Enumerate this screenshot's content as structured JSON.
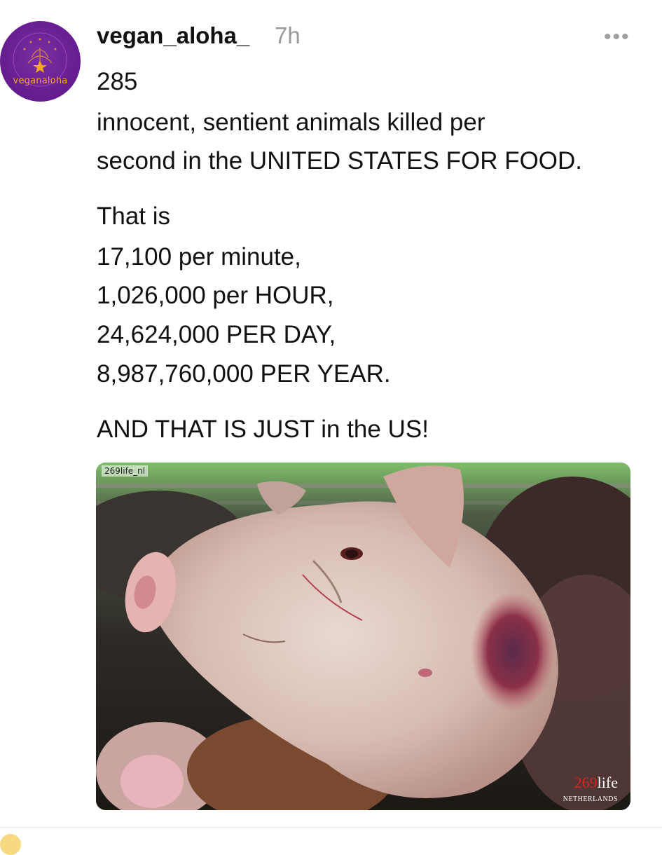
{
  "post": {
    "avatar_text": "veganaloha",
    "username": "vegan_aloha_",
    "time": "7h",
    "more_icon": "•••",
    "lines": [
      "285",
      "innocent, sentient animals killed per",
      "second in the UNITED STATES FOR FOOD.",
      "That is",
      "17,100 per minute,",
      "1,026,000 per HOUR,",
      "24,624,000 PER DAY,",
      "8,987,760,000 PER YEAR.",
      "AND THAT IS JUST in the US!"
    ],
    "image": {
      "watermark_small": "269life_nl",
      "brand_number": "269",
      "brand_word": "life",
      "brand_sub": "NETHERLANDS"
    }
  },
  "colors": {
    "avatar_bg": "#6a1f94",
    "avatar_accent": "#f5a623",
    "time_gray": "#9a9a9a",
    "brand_red": "#e02020"
  }
}
